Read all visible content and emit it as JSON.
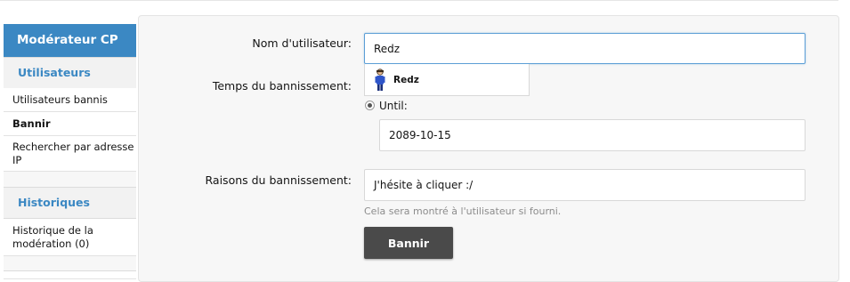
{
  "sidebar": {
    "title": "Modérateur CP",
    "sections": [
      {
        "label": "Utilisateurs"
      },
      {
        "label": "Historiques"
      }
    ],
    "items": [
      {
        "label": "Utilisateurs bannis"
      },
      {
        "label": "Bannir"
      },
      {
        "label": "Rechercher par adresse IP"
      },
      {
        "label": "Historique de la modération (0)"
      }
    ]
  },
  "form": {
    "username_label": "Nom d'utilisateur:",
    "username_value": "Redz",
    "suggestion": {
      "name": "Redz"
    },
    "duration_label": "Temps du bannissement:",
    "until_label": "Until:",
    "until_date": "2089-10-15",
    "reason_label": "Raisons du bannissement:",
    "reason_value": "J'hésite à cliquer :/",
    "reason_hint": "Cela sera montré à l'utilisateur si fourni.",
    "submit_label": "Bannir"
  },
  "colors": {
    "accent": "#3b88c3",
    "button": "#4a4a4a"
  }
}
